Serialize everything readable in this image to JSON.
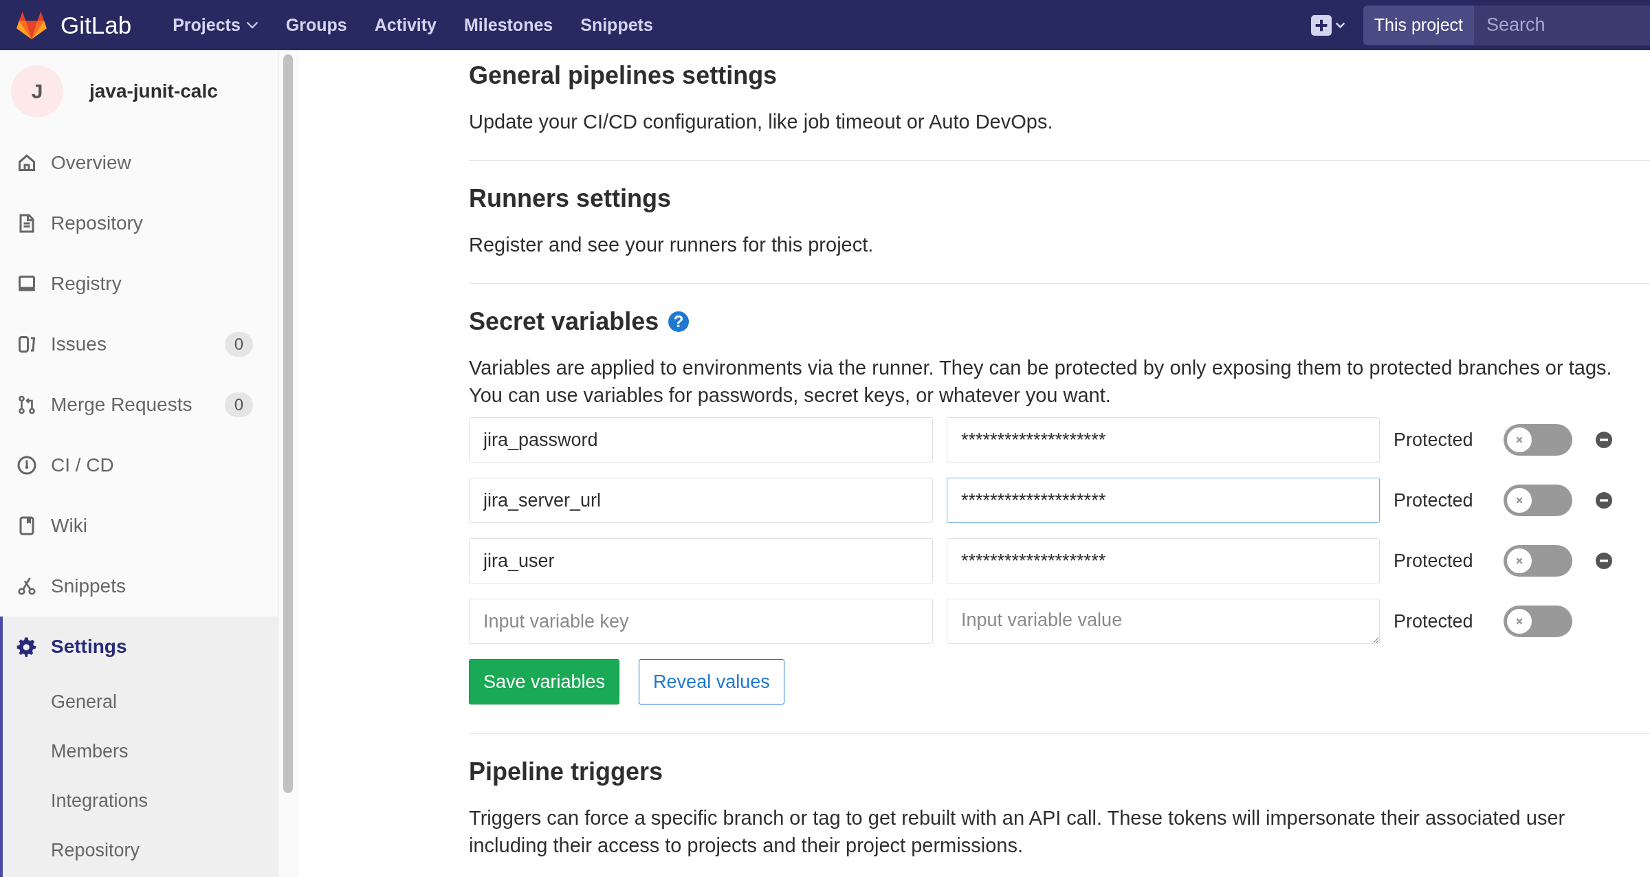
{
  "header": {
    "brand": "GitLab",
    "nav": [
      {
        "label": "Projects",
        "dropdown": true
      },
      {
        "label": "Groups",
        "dropdown": false
      },
      {
        "label": "Activity",
        "dropdown": false
      },
      {
        "label": "Milestones",
        "dropdown": false
      },
      {
        "label": "Snippets",
        "dropdown": false
      }
    ],
    "scope": "This project",
    "search": {
      "placeholder": "Search"
    }
  },
  "sidebar": {
    "project": {
      "avatar": "J",
      "name": "java-junit-calc"
    },
    "items": [
      {
        "label": "Overview",
        "selected": false
      },
      {
        "label": "Repository",
        "selected": false
      },
      {
        "label": "Registry",
        "selected": false
      },
      {
        "label": "Issues",
        "count": "0",
        "selected": false
      },
      {
        "label": "Merge Requests",
        "count": "0",
        "selected": false
      },
      {
        "label": "CI / CD",
        "selected": false
      },
      {
        "label": "Wiki",
        "selected": false
      },
      {
        "label": "Snippets",
        "selected": false
      },
      {
        "label": "Settings",
        "selected": true,
        "children": [
          {
            "label": "General"
          },
          {
            "label": "Members"
          },
          {
            "label": "Integrations"
          },
          {
            "label": "Repository"
          }
        ]
      }
    ]
  },
  "sections": [
    {
      "title": "General pipelines settings",
      "text": [
        "Update your CI/CD configuration, like job timeout or Auto DevOps."
      ]
    },
    {
      "title": "Runners settings",
      "text": [
        "Register and see your runners for this project."
      ]
    },
    {
      "title": "Secret variables",
      "help": "?",
      "text": [
        "Variables are applied to environments via the runner. They can be protected by only exposing them to protected branches or tags.",
        "You can use variables for passwords, secret keys, or whatever you want."
      ],
      "variables": [
        {
          "kind": "saved",
          "key": "jira_password",
          "value": "********************",
          "protected_label": "Protected",
          "protected": false
        },
        {
          "kind": "saved",
          "key": "jira_server_url",
          "value": "********************",
          "protected_label": "Protected",
          "protected": false,
          "focused": true
        },
        {
          "kind": "saved",
          "key": "jira_user",
          "value": "********************",
          "protected_label": "Protected",
          "protected": false
        },
        {
          "kind": "new",
          "key_placeholder": "Input variable key",
          "value_placeholder": "Input variable value",
          "protected_label": "Protected",
          "protected": false
        }
      ],
      "buttons": [
        {
          "label": "Save variables",
          "kind": "primary"
        },
        {
          "label": "Reveal values",
          "kind": "outline"
        }
      ]
    },
    {
      "title": "Pipeline triggers",
      "text": [
        "Triggers can force a specific branch or tag to get rebuilt with an API call. These tokens will impersonate their associated user",
        "including their access to projects and their project permissions."
      ]
    }
  ]
}
